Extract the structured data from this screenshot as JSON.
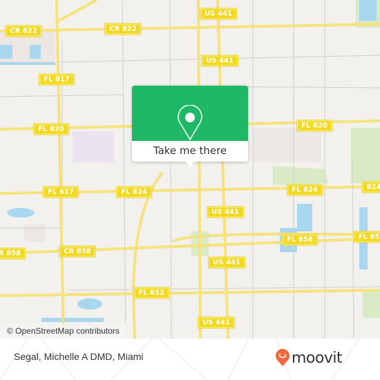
{
  "map": {
    "attribution": "© OpenStreetMap contributors",
    "road_labels": [
      {
        "text": "CR 822",
        "id": "cr-822-west"
      },
      {
        "text": "CR 822",
        "id": "cr-822-east"
      },
      {
        "text": "US 441",
        "id": "us-441-north-1"
      },
      {
        "text": "US 441",
        "id": "us-441-north-2"
      },
      {
        "text": "FL 817",
        "id": "fl-817-north"
      },
      {
        "text": "FL 820",
        "id": "fl-820-west"
      },
      {
        "text": "FL 820",
        "id": "fl-820-east"
      },
      {
        "text": "FL 817",
        "id": "fl-817-south"
      },
      {
        "text": "FL 824",
        "id": "fl-824-west"
      },
      {
        "text": "FL 824",
        "id": "fl-824-east"
      },
      {
        "text": "824",
        "id": "fl-824-edge"
      },
      {
        "text": "US 441",
        "id": "us-441-mid"
      },
      {
        "text": "R 858",
        "id": "cr-858-edge"
      },
      {
        "text": "CR 858",
        "id": "cr-858"
      },
      {
        "text": "FL 858",
        "id": "fl-858"
      },
      {
        "text": "FL 85",
        "id": "fl-858-edge"
      },
      {
        "text": "US 441",
        "id": "us-441-south-1"
      },
      {
        "text": "FL 852",
        "id": "fl-852"
      },
      {
        "text": "US 441",
        "id": "us-441-south-2"
      }
    ]
  },
  "popup": {
    "icon": "map-pin-icon",
    "button_label": "Take me there",
    "color": "#1fb866"
  },
  "footer": {
    "place_title": "Segal, Michelle A DMD, Miami",
    "brand": "moovit",
    "brand_color": "#f26a3d"
  }
}
